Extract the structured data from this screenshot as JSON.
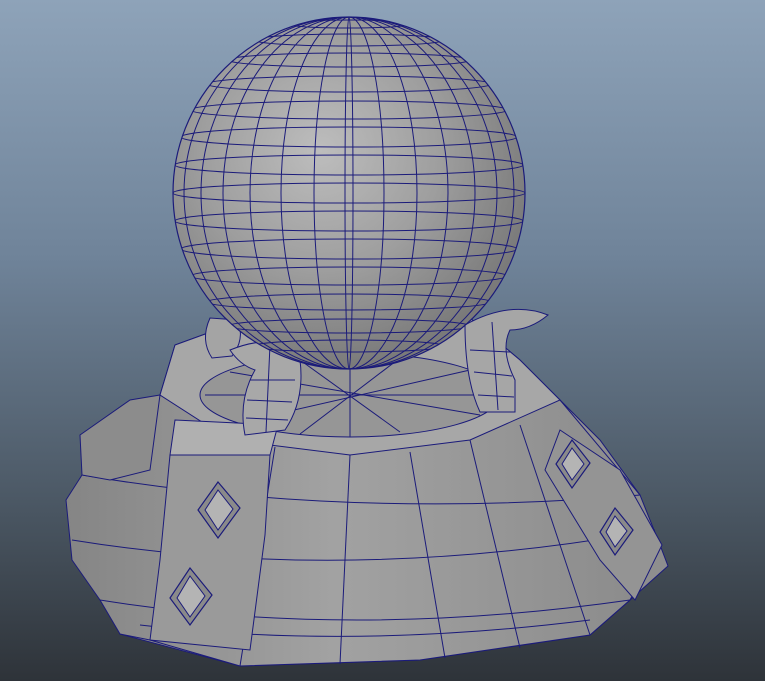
{
  "viewport": {
    "background_top": "#8ea3b9",
    "background_bottom": "#2e3339",
    "mesh_color": "#9b9b9b",
    "wire_color": "#1b1b7a"
  },
  "scene": {
    "objects": [
      "crystal-ball-sphere",
      "claw-legs",
      "octagonal-pedestal-base",
      "diamond-ornaments"
    ]
  }
}
